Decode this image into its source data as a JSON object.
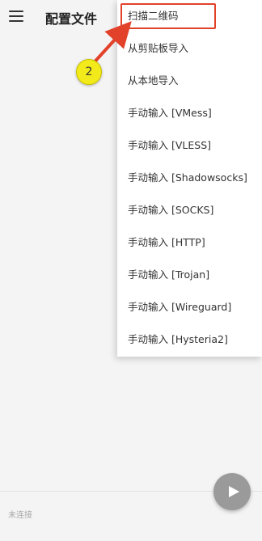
{
  "app_bar": {
    "title": "配置文件",
    "menu_icon": "hamburger-menu-icon"
  },
  "dropdown_menu": {
    "items": [
      "扫描二维码",
      "从剪贴板导入",
      "从本地导入",
      "手动输入 [VMess]",
      "手动输入 [VLESS]",
      "手动输入 [Shadowsocks]",
      "手动输入 [SOCKS]",
      "手动输入 [HTTP]",
      "手动输入 [Trojan]",
      "手动输入 [Wireguard]",
      "手动输入 [Hysteria2]"
    ]
  },
  "annotation": {
    "step_number": "2",
    "highlight_color": "#e2412a",
    "badge_color": "#f2ea1a"
  },
  "footer": {
    "status": "未连接",
    "play_icon": "play-icon"
  }
}
